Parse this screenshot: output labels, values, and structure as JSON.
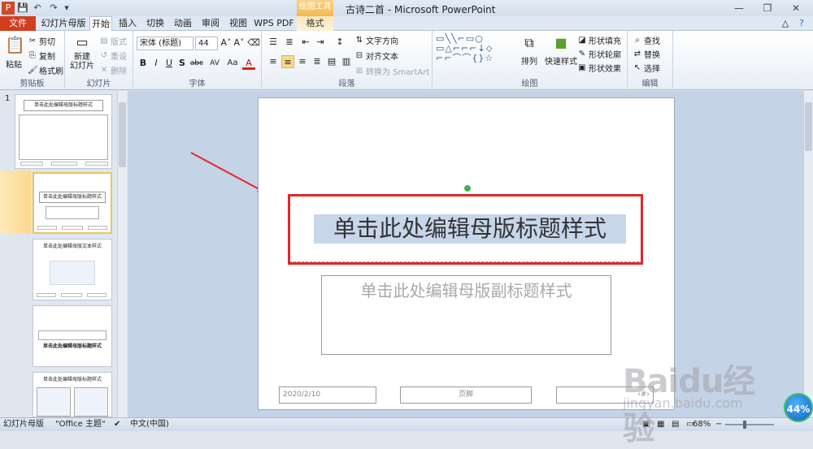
{
  "app": {
    "window_title": "古诗二首 - Microsoft PowerPoint",
    "context_tool": "绘图工具"
  },
  "tabs": [
    "文件",
    "幻灯片母版",
    "开始",
    "插入",
    "切换",
    "动画",
    "审阅",
    "视图",
    "WPS PDF",
    "格式"
  ],
  "active_tab": "开始",
  "ribbon": {
    "clipboard": {
      "paste": "粘贴",
      "cut": "剪切",
      "copy": "复制",
      "format_painter": "格式刷",
      "label": "剪贴板"
    },
    "slides": {
      "new_slide": "新建\n幻灯片",
      "layout": "版式",
      "reset": "重设",
      "delete": "删除",
      "label": "幻灯片"
    },
    "font": {
      "family": "宋体 (标题)",
      "size": "44",
      "label": "字体",
      "bold": "B",
      "italic": "I",
      "underline": "U",
      "shadow": "S",
      "strike": "abc",
      "spacing": "AV",
      "case": "Aa",
      "color": "A"
    },
    "paragraph": {
      "text_direction": "文字方向",
      "align_text": "对齐文本",
      "smartart": "转换为 SmartArt",
      "label": "段落"
    },
    "drawing": {
      "arrange": "排列",
      "quick_styles": "快速样式",
      "shape_fill": "形状填充",
      "shape_outline": "形状轮廓",
      "shape_effects": "形状效果",
      "label": "绘图"
    },
    "editing": {
      "find": "查找",
      "replace": "替换",
      "select": "选择",
      "label": "编辑"
    }
  },
  "thumbnails": [
    {
      "num": "1",
      "title": "单击此处编辑母版标题样式"
    },
    {
      "num": "",
      "title": "单击此处编辑母版标题样式"
    },
    {
      "num": "",
      "title": "单击此处编辑母版文本样式"
    },
    {
      "num": "",
      "title": "单击此处编辑母版标题样式"
    },
    {
      "num": "",
      "title": "单击此处编辑母版标题样式"
    }
  ],
  "slide": {
    "title": "单击此处编辑母版标题样式",
    "subtitle": "单击此处编辑母版副标题样式",
    "date": "2020/2/10",
    "footer": "页脚",
    "page": "‹#›"
  },
  "status": {
    "view": "幻灯片母版",
    "theme": "\"Office 主题\"",
    "language": "中文(中国)",
    "zoom": "68%"
  },
  "watermark": {
    "logo": "Baidu经验",
    "url": "jingyan.baidu.com",
    "badge": "44%"
  }
}
